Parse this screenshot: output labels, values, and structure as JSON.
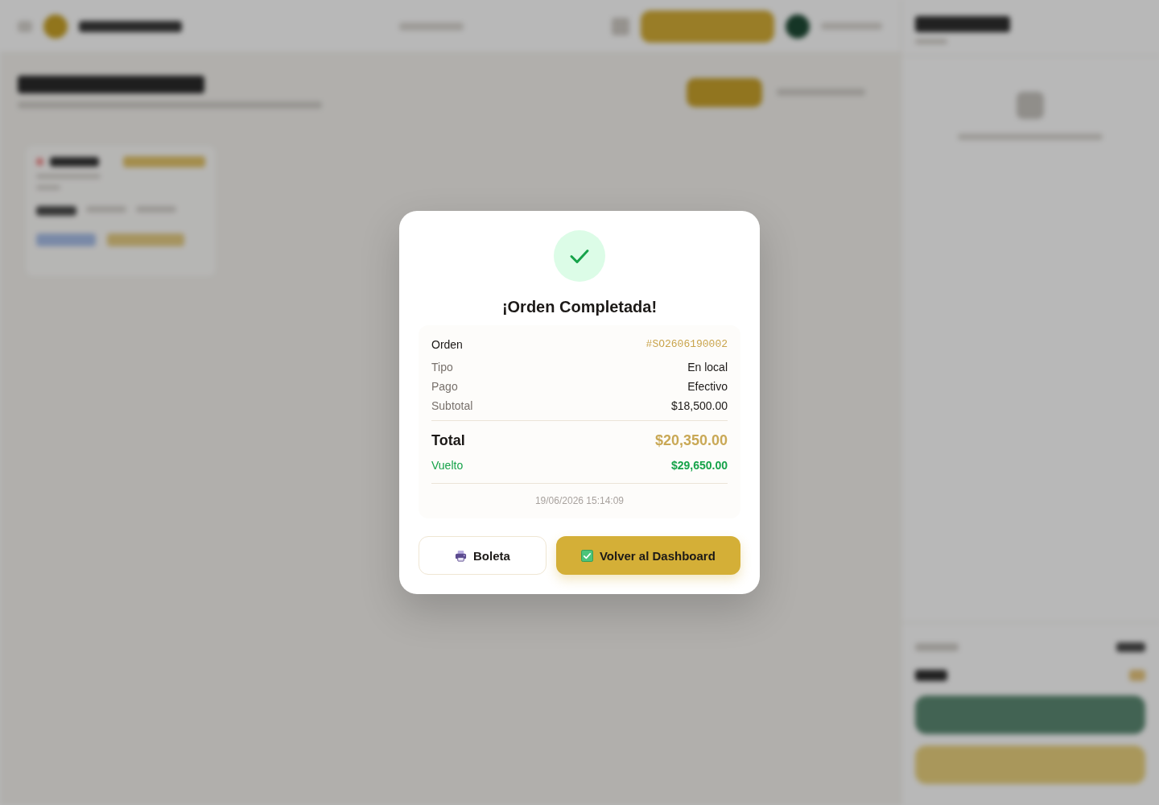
{
  "dialog": {
    "title": "¡Orden Completada!",
    "details": [
      {
        "kind": "order",
        "label": "Orden",
        "value": "#SO2606190002"
      },
      {
        "kind": "info",
        "label": "Tipo",
        "value": "En local"
      },
      {
        "kind": "info",
        "label": "Pago",
        "value": "Efectivo"
      },
      {
        "kind": "info",
        "label": "Subtotal",
        "value": "$18,500.00"
      },
      {
        "kind": "total",
        "label": "Total",
        "value": "$20,350.00"
      },
      {
        "kind": "change",
        "label": "Vuelto",
        "value": "$29,650.00"
      }
    ],
    "timestamp": "19/06/2026 15:14:09",
    "buttons": [
      {
        "kind": "secondary",
        "label": "Boleta"
      },
      {
        "kind": "primary",
        "label": "Volver al Dashboard"
      }
    ]
  }
}
